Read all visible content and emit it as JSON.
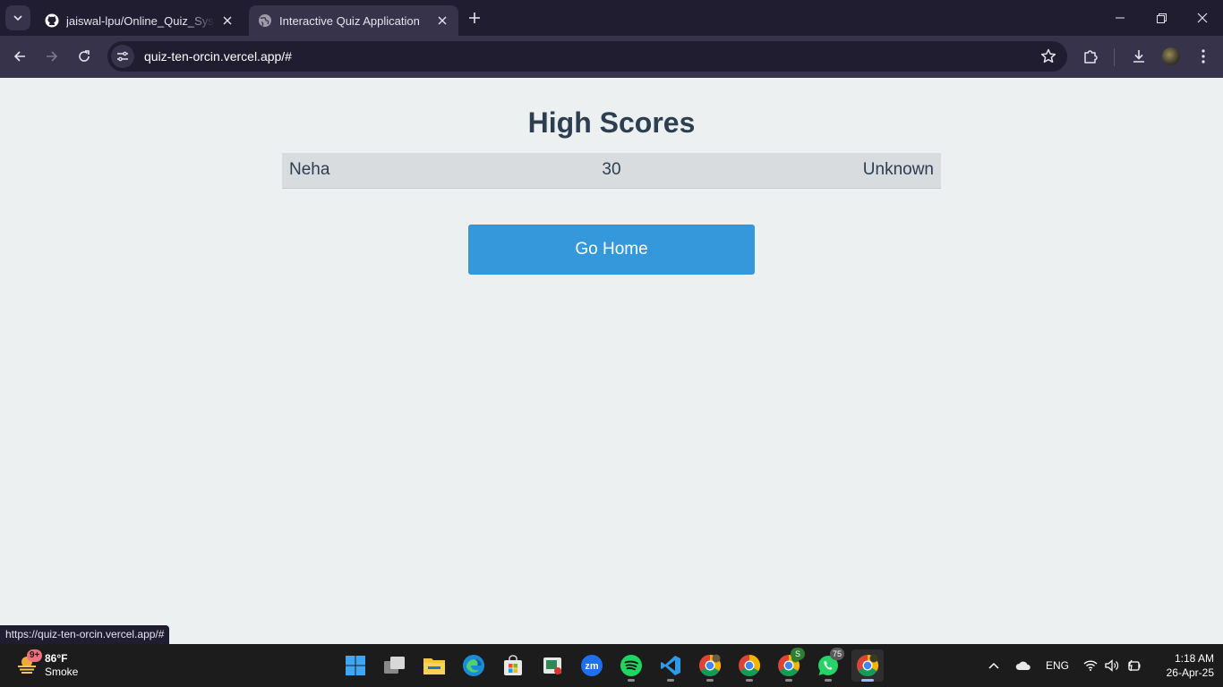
{
  "browser": {
    "tabs": [
      {
        "title": "jaiswal-lpu/Online_Quiz_System",
        "active": false
      },
      {
        "title": "Interactive Quiz Application",
        "active": true
      }
    ],
    "url": "quiz-ten-orcin.vercel.app/#",
    "status_url": "https://quiz-ten-orcin.vercel.app/#"
  },
  "page": {
    "title": "High Scores",
    "scores": [
      {
        "name": "Neha",
        "score": "30",
        "date": "Unknown"
      }
    ],
    "home_button": "Go Home"
  },
  "taskbar": {
    "weather": {
      "badge": "9+",
      "temp": "86°F",
      "condition": "Smoke"
    },
    "whatsapp_badge": "75",
    "chrome_profile_badge": "S",
    "language": "ENG",
    "time": "1:18 AM",
    "date": "26-Apr-25"
  },
  "colors": {
    "accent": "#3498db",
    "heading": "#2c3e50",
    "page_bg": "#ecf0f1",
    "row_bg": "#d8dcdf"
  }
}
